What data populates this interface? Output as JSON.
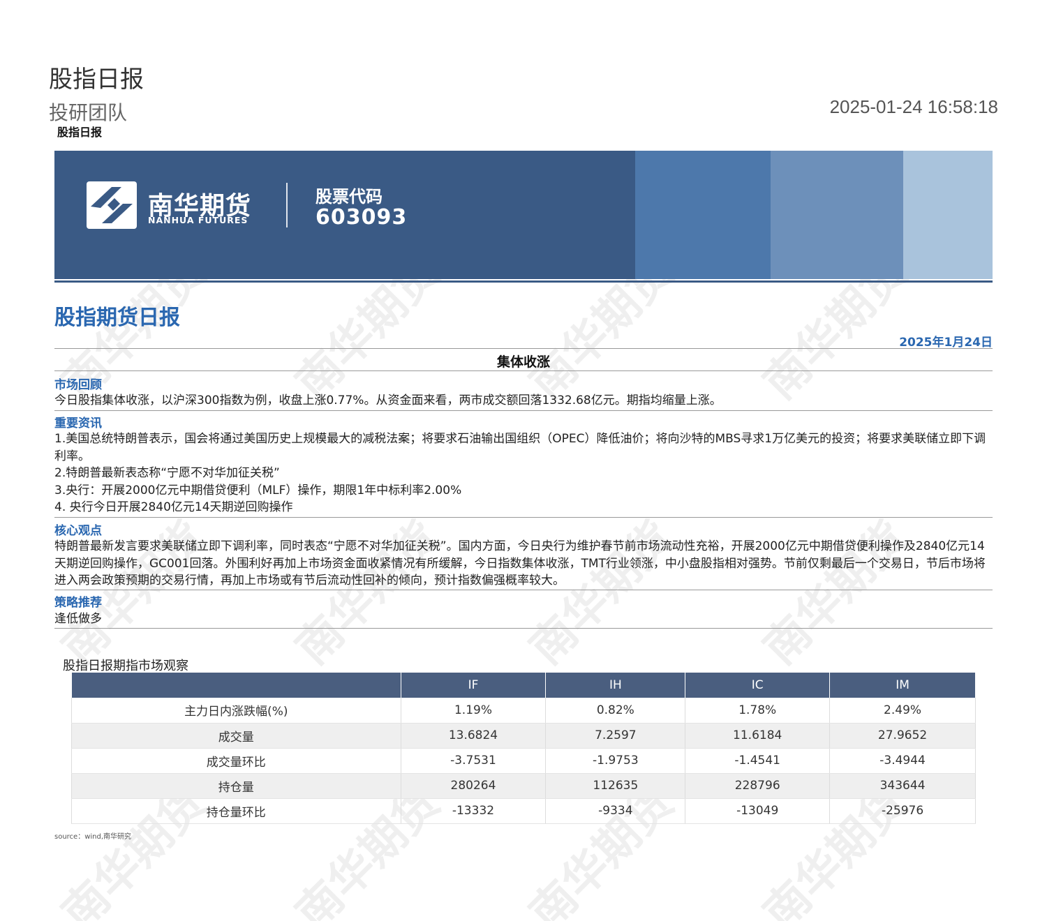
{
  "header": {
    "title": "股指日报",
    "subtitle": "投研团队",
    "timestamp": "2025-01-24 16:58:18",
    "small_title": "股指日报"
  },
  "banner": {
    "logo_cn": "南华期货",
    "logo_en": "NANHUA FUTURES",
    "code_label": "股票代码",
    "code_value": "603093",
    "colors": {
      "base": "#3a5a85",
      "band1": "#4d78ab",
      "band2": "#6d90ba",
      "band3": "#a9c3dc"
    }
  },
  "report": {
    "title": "股指期货日报",
    "date": "2025年1月24日",
    "headline": "集体收涨",
    "accent_color": "#2a67b0"
  },
  "sections": {
    "review": {
      "heading": "市场回顾",
      "body": "今日股指集体收涨，以沪深300指数为例，收盘上涨0.77%。从资金面来看，两市成交额回落1332.68亿元。期指均缩量上涨。"
    },
    "news": {
      "heading": "重要资讯",
      "items": [
        "1.美国总统特朗普表示，国会将通过美国历史上规模最大的减税法案；将要求石油输出国组织（OPEC）降低油价；将向沙特的MBS寻求1万亿美元的投资；将要求美联储立即下调利率。",
        "2.特朗普最新表态称“宁愿不对华加征关税”",
        "3.央行：开展2000亿元中期借贷便利（MLF）操作，期限1年中标利率2.00%",
        "4. 央行今日开展2840亿元14天期逆回购操作"
      ]
    },
    "view": {
      "heading": "核心观点",
      "body": "特朗普最新发言要求美联储立即下调利率，同时表态“宁愿不对华加征关税”。国内方面，今日央行为维护春节前市场流动性充裕，开展2000亿元中期借贷便利操作及2840亿元14天期逆回购操作，GC001回落。外围利好再加上市场资金面收紧情况有所缓解，今日指数集体收涨，TMT行业领涨，中小盘股指相对强势。节前仅剩最后一个交易日，节后市场将进入两会政策预期的交易行情，再加上市场或有节后流动性回补的倾向，预计指数偏强概率较大。"
    },
    "strategy": {
      "heading": "策略推荐",
      "body": "逢低做多"
    }
  },
  "table": {
    "title": "股指日报期指市场观察",
    "columns": [
      "",
      "IF",
      "IH",
      "IC",
      "IM"
    ],
    "rows": [
      [
        "主力日内涨跌幅(%)",
        "1.19%",
        "0.82%",
        "1.78%",
        "2.49%"
      ],
      [
        "成交量",
        "13.6824",
        "7.2597",
        "11.6184",
        "27.9652"
      ],
      [
        "成交量环比",
        "-3.7531",
        "-1.9753",
        "-1.4541",
        "-3.4944"
      ],
      [
        "持仓量",
        "280264",
        "112635",
        "228796",
        "343644"
      ],
      [
        "持仓量环比",
        "-13332",
        "-9334",
        "-13049",
        "-25976"
      ]
    ],
    "source": "source：wind,南华研究"
  },
  "watermark": {
    "text": "南华期货"
  }
}
